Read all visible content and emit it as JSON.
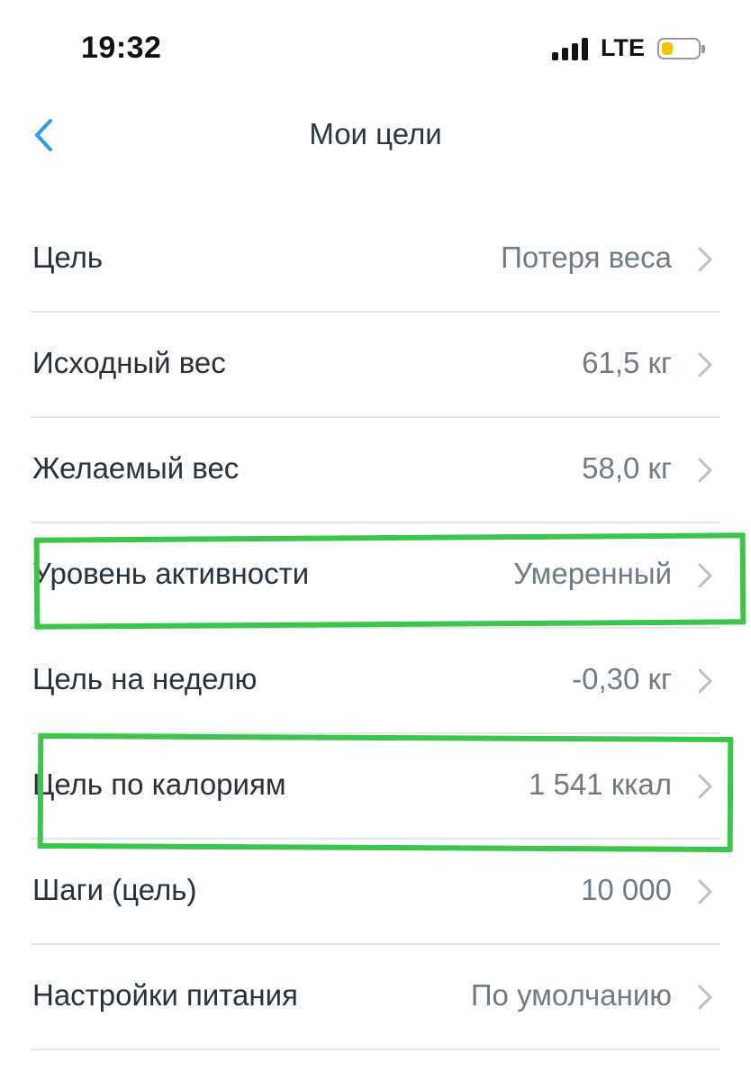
{
  "status_bar": {
    "time": "19:32",
    "network": "LTE",
    "battery_level": 0.35,
    "battery_color": "#f5c400"
  },
  "nav": {
    "title": "Мои цели",
    "back_icon": "chevron-left-icon",
    "accent_color": "#2f9be0"
  },
  "goals": [
    {
      "label": "Цель",
      "value": "Потеря веса"
    },
    {
      "label": "Исходный вес",
      "value": "61,5 кг"
    },
    {
      "label": "Желаемый вес",
      "value": "58,0 кг"
    },
    {
      "label": "Уровень активности",
      "value": "Умеренный"
    },
    {
      "label": "Цель на неделю",
      "value": "-0,30 кг"
    },
    {
      "label": "Цель по калориям",
      "value": "1 541 ккал"
    },
    {
      "label": "Шаги (цель)",
      "value": "10 000"
    },
    {
      "label": "Настройки питания",
      "value": "По умолчанию"
    }
  ],
  "row_icon": "chevron-right-icon",
  "annotations": {
    "highlight_color": "#3cc54a",
    "highlighted_rows": [
      "Уровень активности",
      "Цель по калориям"
    ]
  }
}
